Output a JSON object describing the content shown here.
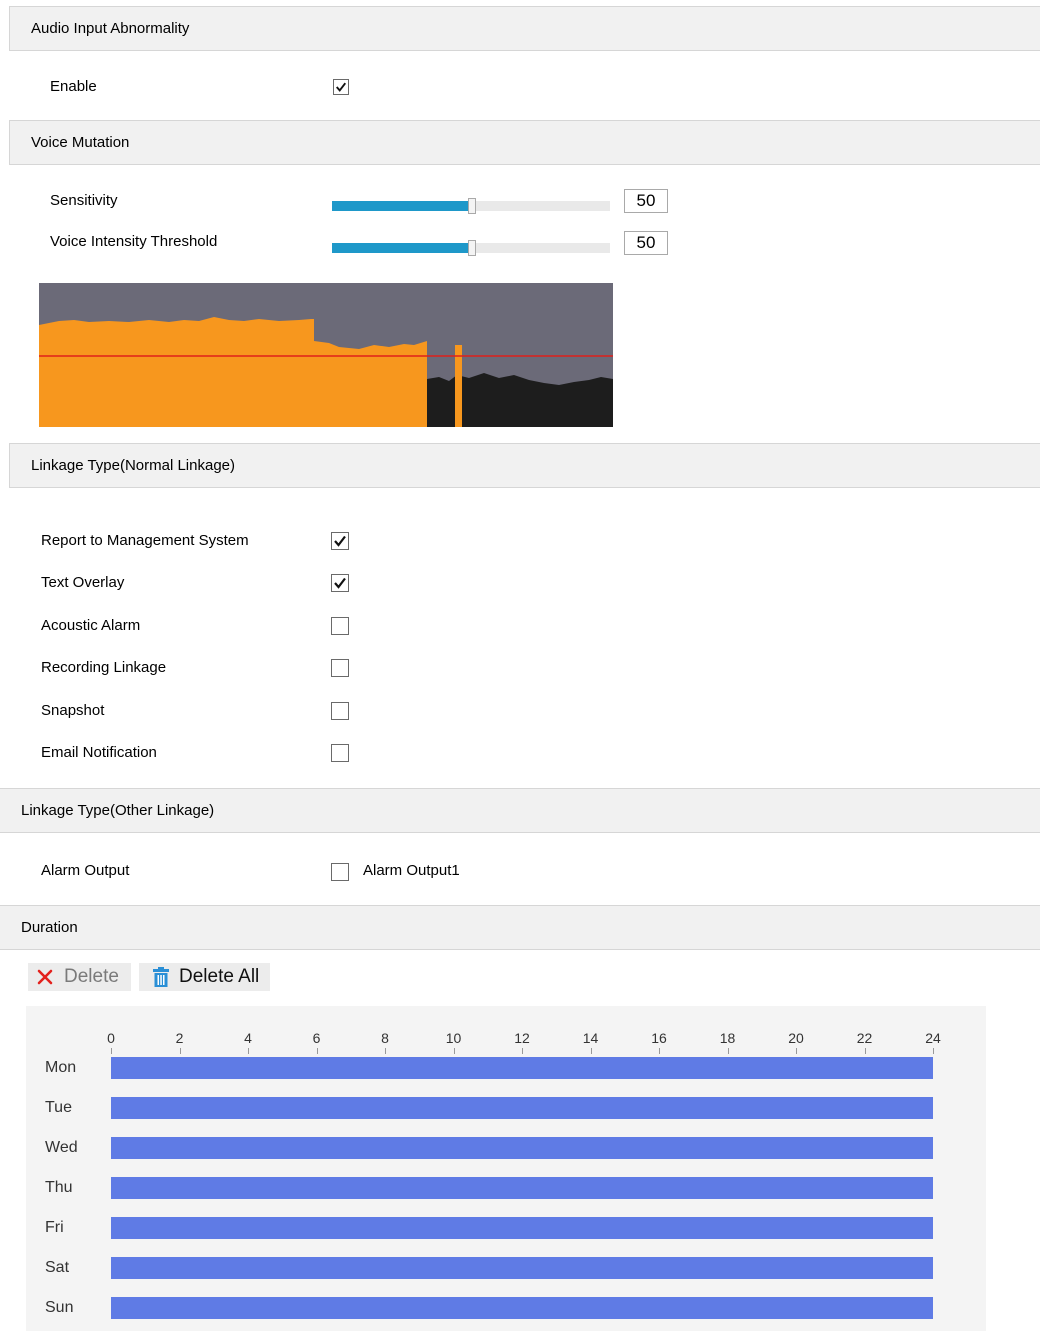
{
  "sections": {
    "audio_input": "Audio Input Abnormality",
    "voice_mutation": "Voice Mutation",
    "normal_linkage": "Linkage Type(Normal Linkage)",
    "other_linkage": "Linkage Type(Other Linkage)",
    "duration": "Duration"
  },
  "audio_input": {
    "enable_label": "Enable",
    "enable_checked": true
  },
  "voice_mutation": {
    "sensitivity_label": "Sensitivity",
    "sensitivity_value": "50",
    "threshold_label": "Voice Intensity Threshold",
    "threshold_value": "50"
  },
  "waveform": {
    "threshold_level": 0.5,
    "colors": {
      "background": "#6b6a78",
      "active": "#f7971e",
      "inactive": "#1d1d1d",
      "threshold": "#e0201a"
    }
  },
  "normal_linkage": {
    "items": [
      {
        "label": "Report to Management System",
        "checked": true
      },
      {
        "label": "Text Overlay",
        "checked": true
      },
      {
        "label": "Acoustic Alarm",
        "checked": false
      },
      {
        "label": "Recording Linkage",
        "checked": false
      },
      {
        "label": "Snapshot",
        "checked": false
      },
      {
        "label": "Email Notification",
        "checked": false
      }
    ]
  },
  "other_linkage": {
    "alarm_output_label": "Alarm Output",
    "alarm_output1_label": "Alarm Output1",
    "alarm_output1_checked": false
  },
  "duration": {
    "delete_label": "Delete",
    "delete_all_label": "Delete All",
    "hour_ticks": [
      "0",
      "2",
      "4",
      "6",
      "8",
      "10",
      "12",
      "14",
      "16",
      "18",
      "20",
      "22",
      "24"
    ],
    "days": [
      {
        "label": "Mon",
        "start": 0,
        "end": 24
      },
      {
        "label": "Tue",
        "start": 0,
        "end": 24
      },
      {
        "label": "Wed",
        "start": 0,
        "end": 24
      },
      {
        "label": "Thu",
        "start": 0,
        "end": 24
      },
      {
        "label": "Fri",
        "start": 0,
        "end": 24
      },
      {
        "label": "Sat",
        "start": 0,
        "end": 24
      },
      {
        "label": "Sun",
        "start": 0,
        "end": 24
      }
    ],
    "bar_color": "#5f7be5"
  }
}
